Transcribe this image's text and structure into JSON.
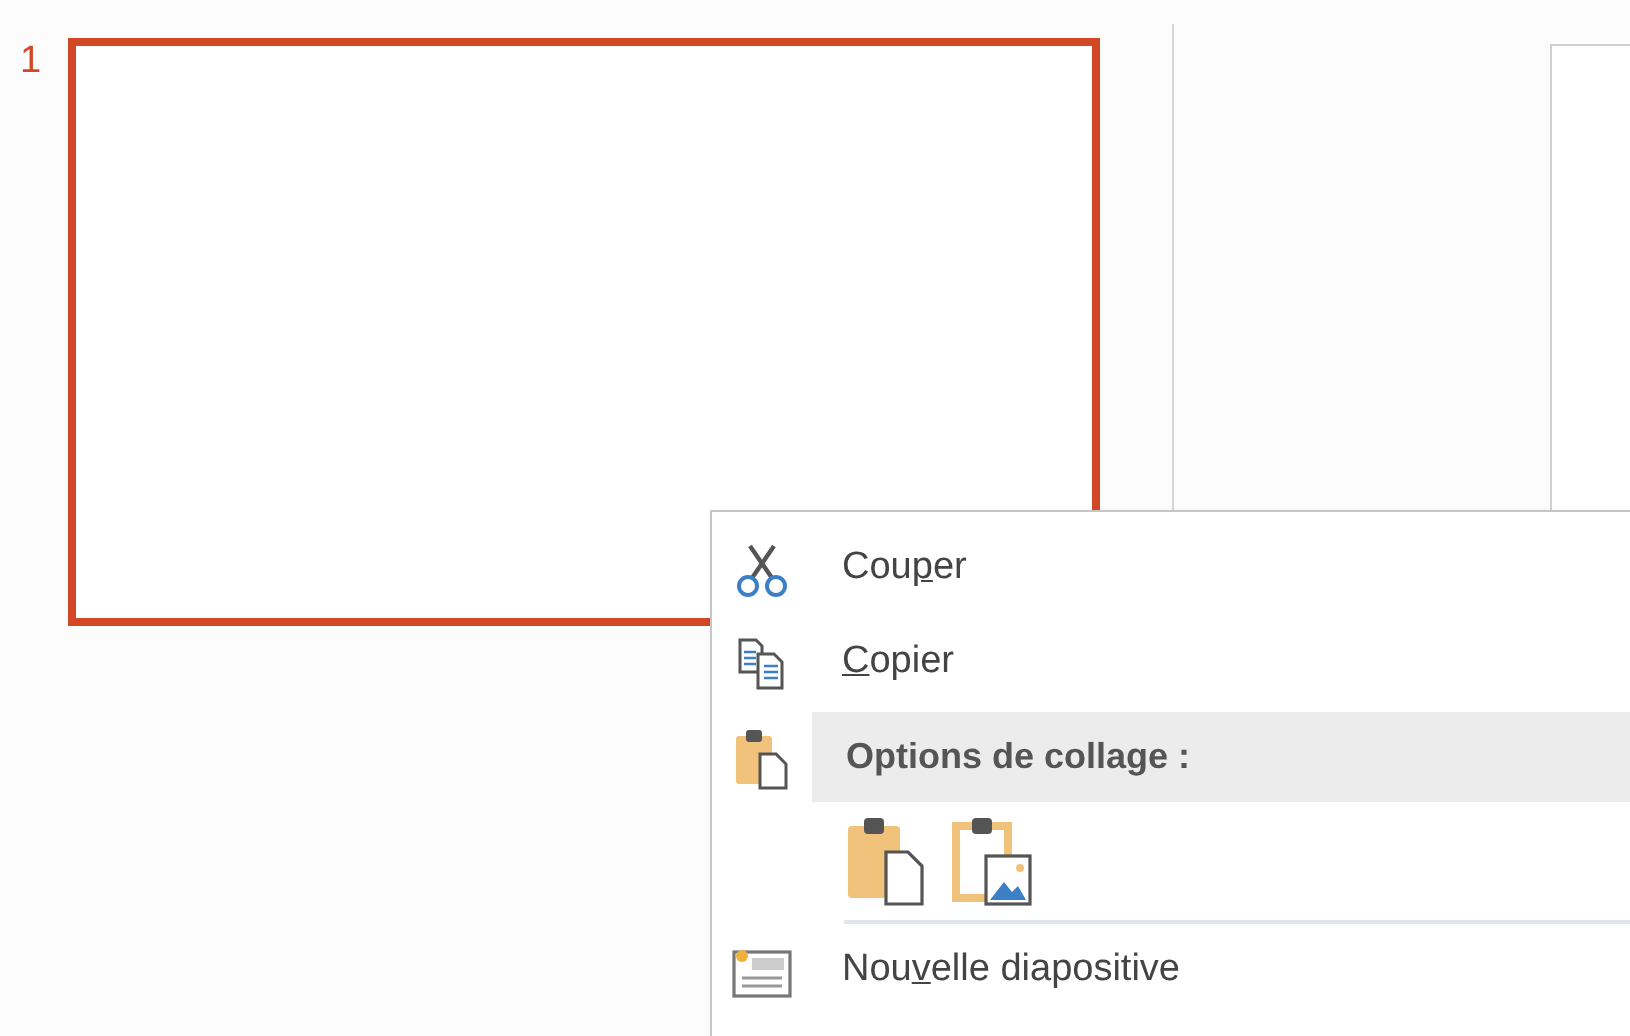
{
  "slides": [
    {
      "number": "1",
      "selected": true
    }
  ],
  "context_menu": {
    "items": [
      {
        "kind": "command",
        "label_before": "Cou",
        "mnemonic": "p",
        "label_after": "er"
      },
      {
        "kind": "command",
        "mnemonic": "C",
        "label_after": "opier"
      },
      {
        "kind": "header",
        "label": "Options de collage :"
      },
      {
        "kind": "paste_buttons",
        "buttons": [
          {
            "kind": "document"
          },
          {
            "kind": "picture"
          }
        ]
      },
      {
        "kind": "command",
        "label_before": "Nou",
        "mnemonic": "v",
        "label_after": "elle diapositive"
      }
    ]
  }
}
